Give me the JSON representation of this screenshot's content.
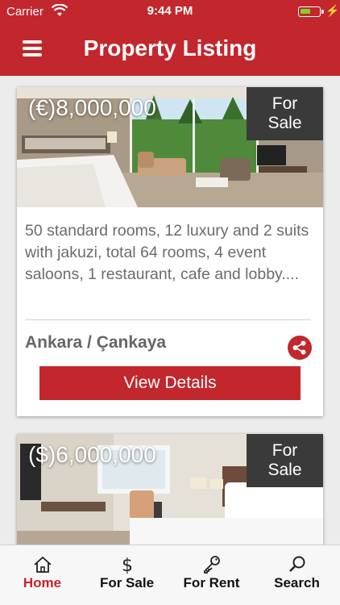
{
  "status_bar": {
    "carrier": "Carrier",
    "time": "9:44 PM",
    "charging_icon": "bolt-icon"
  },
  "nav": {
    "title": "Property Listing",
    "menu_icon": "hamburger-menu-icon"
  },
  "listings": [
    {
      "price": "(€)8,000,000",
      "tag": "For Sale",
      "description": "50 standard rooms, 12 luxury and 2 suits with jakuzi, total 64 rooms, 4 event saloons, 1 restaurant, cafe and lobby....",
      "location": "Ankara / Çankaya",
      "details_label": "View Details"
    },
    {
      "price": "($)6,000,000",
      "tag": "For Sale"
    }
  ],
  "tabs": [
    {
      "label": "Home",
      "icon": "home-icon",
      "active": true
    },
    {
      "label": "For Sale",
      "icon": "dollar-icon",
      "active": false
    },
    {
      "label": "For Rent",
      "icon": "key-icon",
      "active": false
    },
    {
      "label": "Search",
      "icon": "search-icon",
      "active": false
    }
  ],
  "colors": {
    "accent": "#c2272d",
    "tag_bg": "#3a3a3a",
    "battery": "#7ed321"
  }
}
